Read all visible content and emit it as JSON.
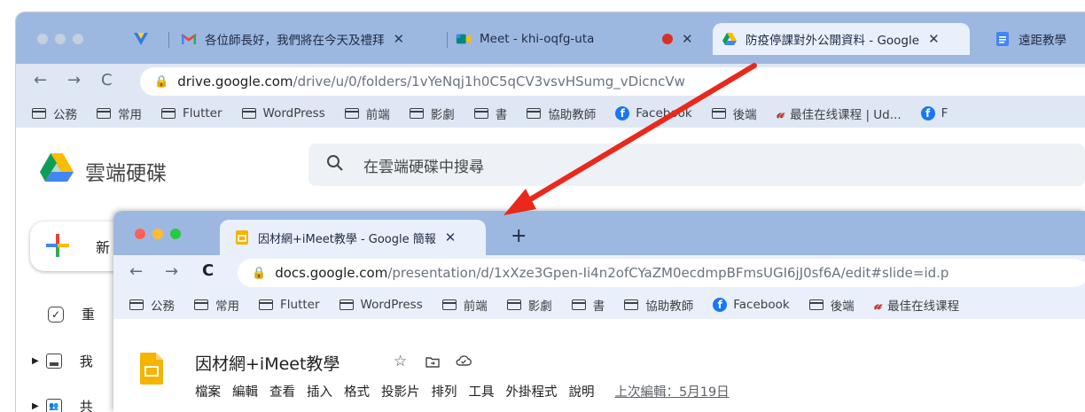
{
  "back_window": {
    "tabs": [
      {
        "label": "各位師長好，我們將在今天及禮拜",
        "icon": "gmail-icon"
      },
      {
        "label": "Meet - khi-oqfg-uta",
        "icon": "meet-icon"
      },
      {
        "label": "防疫停課對外公開資料 - Google",
        "icon": "drive-icon"
      },
      {
        "label": "遠距教學",
        "icon": "docs-icon"
      }
    ],
    "url_host": "drive.google.com",
    "url_path": "/drive/u/0/folders/1vYeNqj1h0C5qCV3vsvHSumg_vDicncVw",
    "bookmarks": [
      {
        "label": "公務",
        "icon": "folder-icon"
      },
      {
        "label": "常用",
        "icon": "folder-icon"
      },
      {
        "label": "Flutter",
        "icon": "folder-icon"
      },
      {
        "label": "WordPress",
        "icon": "folder-icon"
      },
      {
        "label": "前端",
        "icon": "folder-icon"
      },
      {
        "label": "影劇",
        "icon": "folder-icon"
      },
      {
        "label": "書",
        "icon": "folder-icon"
      },
      {
        "label": "協助教師",
        "icon": "folder-icon"
      },
      {
        "label": "Facebook",
        "icon": "facebook-icon"
      },
      {
        "label": "後端",
        "icon": "folder-icon"
      },
      {
        "label": "最佳在线课程 | Ud...",
        "icon": "udemy-icon"
      },
      {
        "label": "F",
        "icon": "facebook-icon"
      }
    ],
    "app_name": "雲端硬碟",
    "search_placeholder": "在雲端硬碟中搜尋",
    "new_button": "新",
    "sidebar": [
      {
        "label": "重",
        "icon": "check-circle-icon"
      },
      {
        "label": "我",
        "icon": "drive-folder-icon"
      },
      {
        "label": "共",
        "icon": "shared-icon"
      }
    ]
  },
  "front_window": {
    "tab_label": "因材網+iMeet教學 - Google 簡報",
    "new_tab": "+",
    "url_host": "docs.google.com",
    "url_path": "/presentation/d/1xXze3Gpen-Ii4n2ofCYaZM0ecdmpBFmsUGI6jJ0sf6A/edit#slide=id.p",
    "bookmarks": [
      {
        "label": "公務",
        "icon": "folder-icon"
      },
      {
        "label": "常用",
        "icon": "folder-icon"
      },
      {
        "label": "Flutter",
        "icon": "folder-icon"
      },
      {
        "label": "WordPress",
        "icon": "folder-icon"
      },
      {
        "label": "前端",
        "icon": "folder-icon"
      },
      {
        "label": "影劇",
        "icon": "folder-icon"
      },
      {
        "label": "書",
        "icon": "folder-icon"
      },
      {
        "label": "協助教師",
        "icon": "folder-icon"
      },
      {
        "label": "Facebook",
        "icon": "facebook-icon"
      },
      {
        "label": "後端",
        "icon": "folder-icon"
      },
      {
        "label": "最佳在线课程",
        "icon": "udemy-icon"
      }
    ],
    "doc_title": "因材網+iMeet教學",
    "menu": [
      "檔案",
      "編輯",
      "查看",
      "插入",
      "格式",
      "投影片",
      "排列",
      "工具",
      "外掛程式",
      "說明"
    ],
    "last_edit": "上次編輯：5月19日"
  },
  "colors": {
    "annotation_arrow": "#e8291c",
    "tabbar": "#9db8e0",
    "toolbar": "#dfe7f4"
  }
}
